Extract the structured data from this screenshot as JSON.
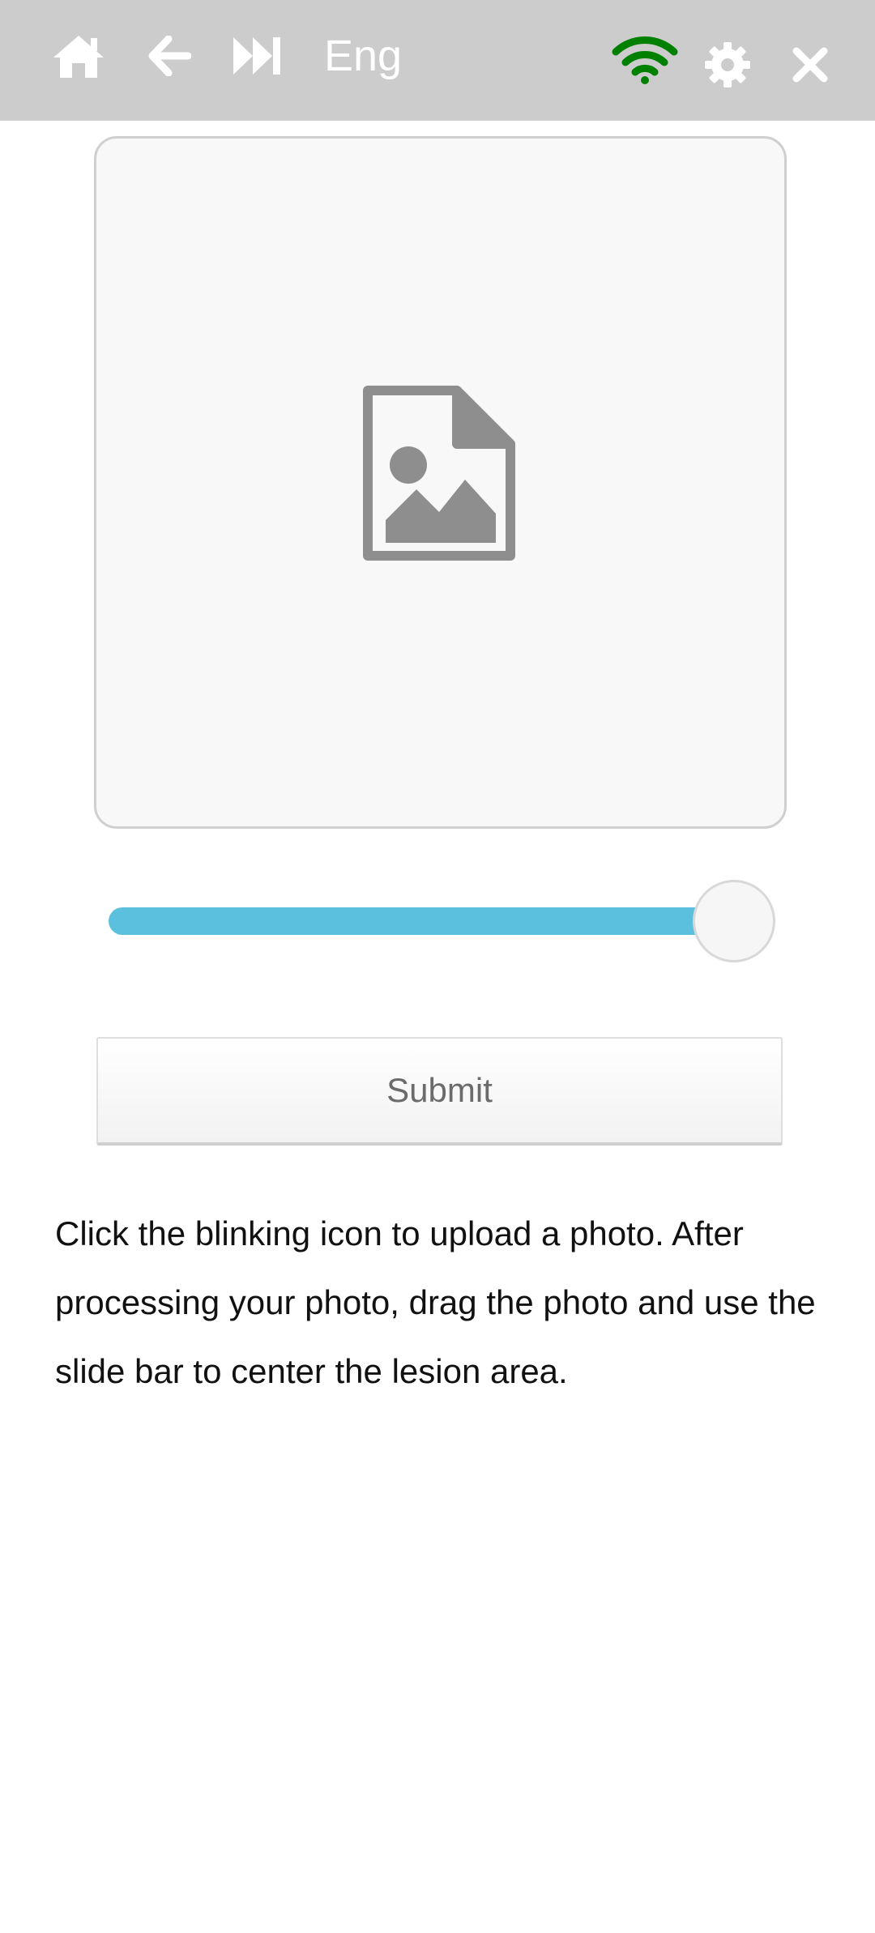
{
  "toolbar": {
    "home_icon": "home-icon",
    "back_icon": "arrow-left-icon",
    "skip_icon": "fast-forward-icon",
    "language_label": "Eng",
    "wifi_icon": "wifi-icon",
    "settings_icon": "gear-icon",
    "close_icon": "close-icon",
    "background_color": "#cccccc",
    "icon_color": "#ffffff",
    "wifi_color": "#008000"
  },
  "photo_upload": {
    "placeholder_icon": "image-file-icon"
  },
  "slider": {
    "value": 1.0,
    "track_color": "#5bc0de"
  },
  "submit_label": "Submit",
  "instructions": "Click the blinking icon to upload a photo. After processing your photo, drag the photo and use the slide bar to center the lesion area."
}
